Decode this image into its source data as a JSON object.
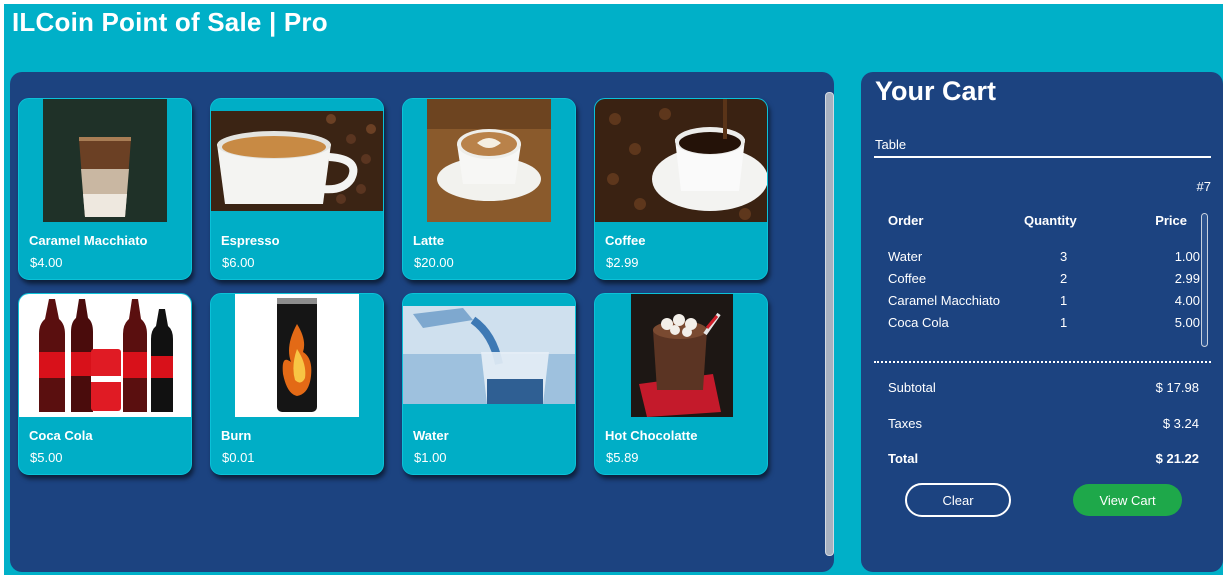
{
  "app": {
    "title": "ILCoin Point of Sale | Pro"
  },
  "products": [
    {
      "name": "Caramel Macchiato",
      "price": "$4.00",
      "image": "iced-caramel-macchiato-photo"
    },
    {
      "name": "Espresso",
      "price": "$6.00",
      "image": "espresso-cup-photo"
    },
    {
      "name": "Latte",
      "price": "$20.00",
      "image": "latte-art-cup-photo"
    },
    {
      "name": "Coffee",
      "price": "$2.99",
      "image": "coffee-cup-beans-photo"
    },
    {
      "name": "Coca Cola",
      "price": "$5.00",
      "image": "coca-cola-bottles-photo"
    },
    {
      "name": "Burn",
      "price": "$0.01",
      "image": "burn-energy-can-photo"
    },
    {
      "name": "Water",
      "price": "$1.00",
      "image": "water-pouring-glass-photo"
    },
    {
      "name": "Hot Chocolatte",
      "price": "$5.89",
      "image": "hot-chocolate-marshmallow-photo"
    }
  ],
  "cart": {
    "title": "Your Cart",
    "table_label": "Table",
    "table_number": "#7",
    "columns": {
      "order": "Order",
      "quantity": "Quantity",
      "price": "Price"
    },
    "items": [
      {
        "name": "Water",
        "quantity": "3",
        "price": "1.00"
      },
      {
        "name": "Coffee",
        "quantity": "2",
        "price": "2.99"
      },
      {
        "name": "Caramel Macchiato",
        "quantity": "1",
        "price": "4.00"
      },
      {
        "name": "Coca Cola",
        "quantity": "1",
        "price": "5.00"
      }
    ],
    "subtotal_label": "Subtotal",
    "subtotal_value": "$ 17.98",
    "taxes_label": "Taxes",
    "taxes_value": "$ 3.24",
    "total_label": "Total",
    "total_value": "$ 21.22",
    "clear_label": "Clear",
    "view_cart_label": "View Cart"
  },
  "colors": {
    "background": "#00b0c8",
    "panel": "#1c4380",
    "card": "#00aec6",
    "view_cart_button": "#1ea84a",
    "text": "#ffffff"
  }
}
